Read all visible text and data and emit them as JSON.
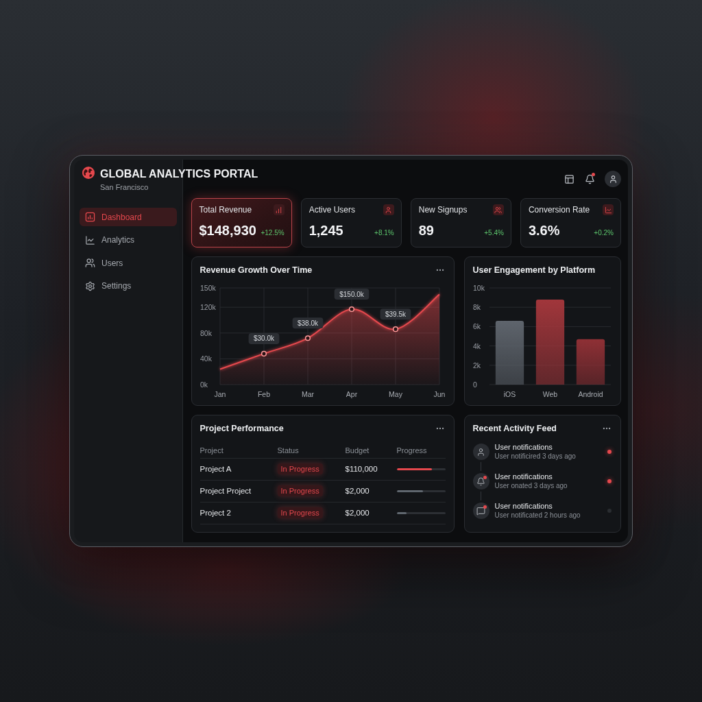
{
  "header": {
    "title": "GLOBAL ANALYTICS PORTAL",
    "subtitle": "San Francisco",
    "notifications_unread": true
  },
  "sidebar": {
    "items": [
      {
        "label": "Dashboard",
        "selected": true
      },
      {
        "label": "Analytics",
        "selected": false
      },
      {
        "label": "Users",
        "selected": false
      },
      {
        "label": "Settings",
        "selected": false
      }
    ]
  },
  "kpi_cards": [
    {
      "label": "Total Revenue",
      "value": "$148,930",
      "change": "+12.5%",
      "selected": true
    },
    {
      "label": "Active Users",
      "value": "1,245",
      "change": "+8.1%",
      "selected": false
    },
    {
      "label": "New Signups",
      "value": "89",
      "change": "+5.4%",
      "selected": false
    },
    {
      "label": "Conversion Rate",
      "value": "3.6%",
      "change": "+0.2%",
      "selected": false
    }
  ],
  "revenue_chart": {
    "chart_data": {
      "type": "area",
      "title": "Revenue Growth Over Time",
      "categories": [
        "Jan",
        "Feb",
        "Mar",
        "Apr",
        "May",
        "Jun"
      ],
      "series": [
        {
          "color": "#e5484d",
          "values": [
            24,
            48,
            72,
            117,
            86,
            140
          ]
        }
      ],
      "ylim": [
        0,
        150
      ],
      "yticks": [
        {
          "value": 0,
          "label": "0k"
        },
        {
          "value": 40,
          "label": "40k"
        },
        {
          "value": 80,
          "label": "80k"
        },
        {
          "value": 120,
          "label": "120k"
        },
        {
          "value": 150,
          "label": "150k"
        }
      ],
      "grid": true,
      "annotations": [
        {
          "x": "Feb",
          "y": 48,
          "text": "$30.0k"
        },
        {
          "x": "Mar",
          "y": 72,
          "text": "$38.0k"
        },
        {
          "x": "Apr",
          "y": 117,
          "text": "$150.0k"
        },
        {
          "x": "May",
          "y": 86,
          "text": "$39.5k"
        }
      ]
    }
  },
  "engagement_chart": {
    "chart_data": {
      "type": "bar",
      "title": "User Engagement by Platform",
      "categories": [
        "iOS",
        "Web",
        "Android"
      ],
      "values": [
        6.6,
        8.8,
        4.7
      ],
      "colors": [
        "#5e646c",
        "#a1363b",
        "#8f3035"
      ],
      "ylim": [
        0,
        10
      ],
      "yticks": [
        {
          "value": 0,
          "label": "0"
        },
        {
          "value": 2,
          "label": "2k"
        },
        {
          "value": 4,
          "label": "4k"
        },
        {
          "value": 6,
          "label": "6k"
        },
        {
          "value": 8,
          "label": "8k"
        },
        {
          "value": 10,
          "label": "10k"
        }
      ],
      "grid": true
    }
  },
  "project_table": {
    "title": "Project Performance",
    "columns": [
      "Project",
      "Status",
      "Budget",
      "Progress"
    ],
    "rows": [
      {
        "project": "Project A",
        "status": "In Progress",
        "budget": "$110,000",
        "level": 0.73,
        "color": "#e5484d"
      },
      {
        "project": "Project Project",
        "status": "In Progress",
        "budget": "$2,000",
        "level": 0.54,
        "color": "#5f666e"
      },
      {
        "project": "Project 2",
        "status": "In Progress",
        "budget": "$2,000",
        "level": 0.2,
        "color": "#5f666e"
      }
    ]
  },
  "activity_feed": {
    "title": "Recent Activity Feed",
    "items": [
      {
        "kind": "user",
        "title": "User notifications",
        "detail": "User notificired 3 days ago",
        "unread": true
      },
      {
        "kind": "alert",
        "title": "User notifications",
        "detail": "User onated 3 days ago",
        "unread": true
      },
      {
        "kind": "message",
        "title": "User notifications",
        "detail": "User notificated 2 hours ago",
        "unread": false
      }
    ]
  }
}
